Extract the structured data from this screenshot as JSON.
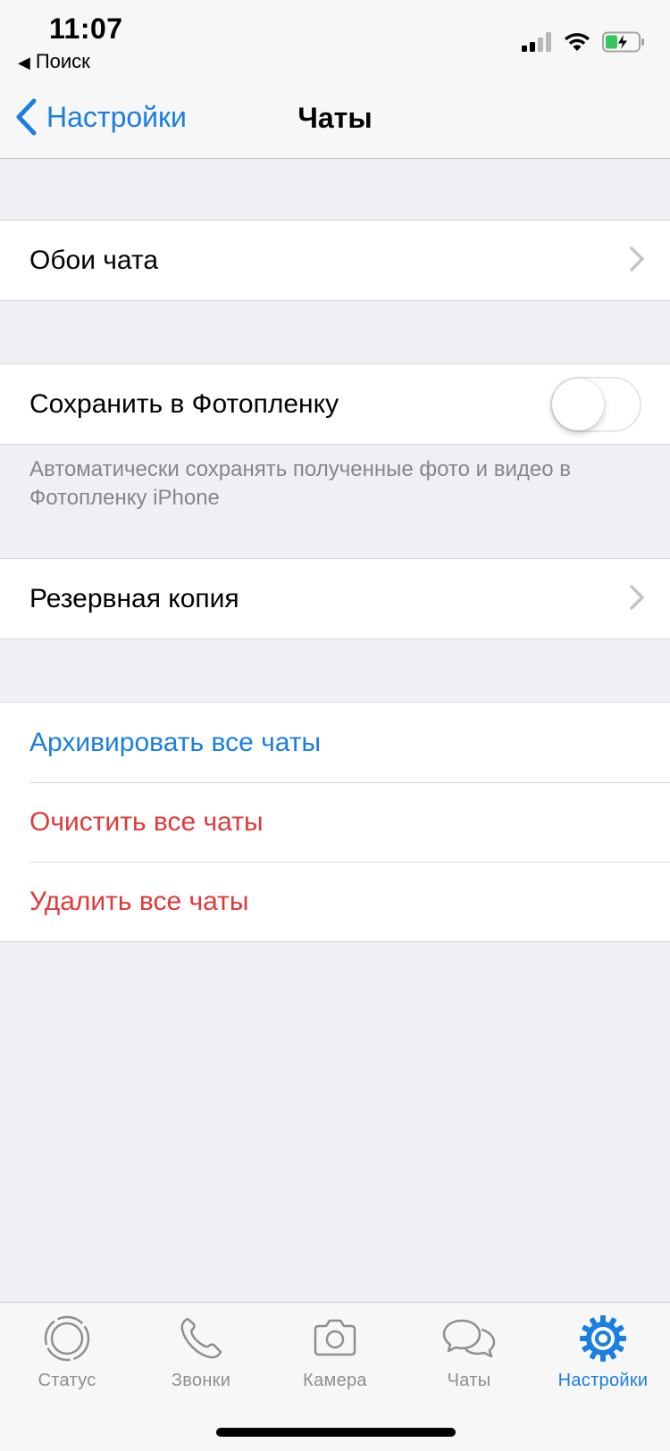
{
  "status_bar": {
    "time": "11:07",
    "back_app_label": "Поиск",
    "back_app_icon": "triangle-left-icon",
    "icons": [
      "signal-icon",
      "wifi-icon",
      "battery-charging-icon"
    ]
  },
  "nav": {
    "back_label": "Настройки",
    "title": "Чаты"
  },
  "settings": {
    "wallpaper_label": "Обои чата",
    "save_to_camera_roll_label": "Сохранить в Фотопленку",
    "save_to_camera_roll_enabled": false,
    "save_footnote": "Автоматически сохранять полученные фото и видео в Фотопленку iPhone",
    "backup_label": "Резервная копия",
    "archive_all_label": "Архивировать все чаты",
    "clear_all_label": "Очистить все чаты",
    "delete_all_label": "Удалить все чаты"
  },
  "tabs": [
    {
      "label": "Статус",
      "icon": "status-icon",
      "active": false
    },
    {
      "label": "Звонки",
      "icon": "phone-icon",
      "active": false
    },
    {
      "label": "Камера",
      "icon": "camera-icon",
      "active": false
    },
    {
      "label": "Чаты",
      "icon": "chat-bubbles-icon",
      "active": false
    },
    {
      "label": "Настройки",
      "icon": "gear-icon",
      "active": true
    }
  ],
  "colors": {
    "accent": "#1a7fe0",
    "destructive": "#e0393b",
    "background": "#efeff4",
    "inactive_tab": "#8e8e93"
  }
}
